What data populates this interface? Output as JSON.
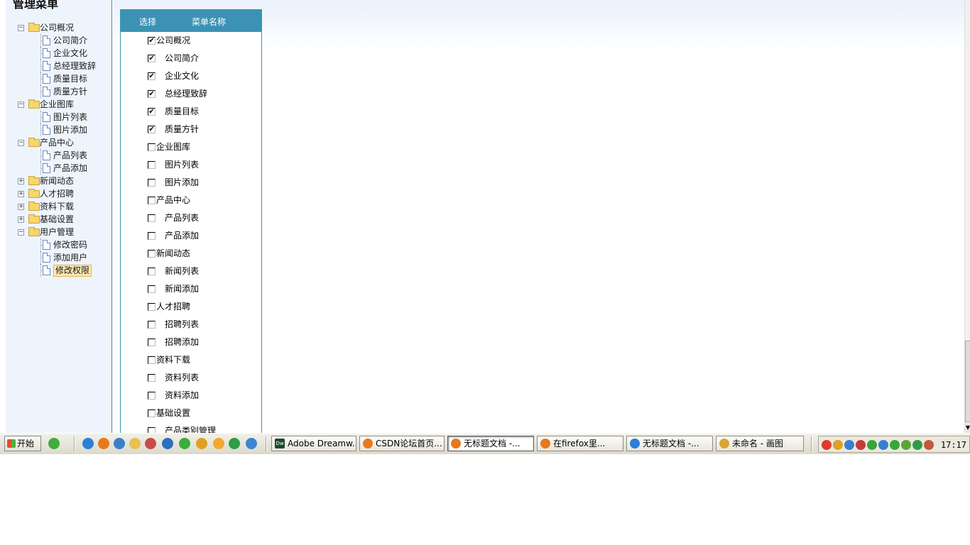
{
  "left_panel": {
    "title": "管理菜单",
    "tree": [
      {
        "label": "公司概况",
        "type": "folder",
        "toggle": "−",
        "expanded": true
      },
      {
        "label": "公司简介",
        "type": "doc"
      },
      {
        "label": "企业文化",
        "type": "doc"
      },
      {
        "label": "总经理致辞",
        "type": "doc"
      },
      {
        "label": "质量目标",
        "type": "doc"
      },
      {
        "label": "质量方针",
        "type": "doc"
      },
      {
        "label": "企业图库",
        "type": "folder",
        "toggle": "−",
        "expanded": true
      },
      {
        "label": "图片列表",
        "type": "doc"
      },
      {
        "label": "图片添加",
        "type": "doc"
      },
      {
        "label": "产品中心",
        "type": "folder",
        "toggle": "−",
        "expanded": true
      },
      {
        "label": "产品列表",
        "type": "doc"
      },
      {
        "label": "产品添加",
        "type": "doc"
      },
      {
        "label": "新闻动态",
        "type": "folder",
        "toggle": "+",
        "expanded": false
      },
      {
        "label": "人才招聘",
        "type": "folder",
        "toggle": "+",
        "expanded": false
      },
      {
        "label": "资料下载",
        "type": "folder",
        "toggle": "+",
        "expanded": false
      },
      {
        "label": "基础设置",
        "type": "folder",
        "toggle": "+",
        "expanded": false
      },
      {
        "label": "用户管理",
        "type": "folder",
        "toggle": "−",
        "expanded": true
      },
      {
        "label": "修改密码",
        "type": "doc"
      },
      {
        "label": "添加用户",
        "type": "doc"
      },
      {
        "label": "修改权限",
        "type": "doc",
        "selected": true
      }
    ]
  },
  "table": {
    "header_select": "选择",
    "header_name": "菜单名称",
    "rows": [
      {
        "label": "公司概况",
        "level": 0,
        "checked": true
      },
      {
        "label": "公司简介",
        "level": 1,
        "checked": true
      },
      {
        "label": "企业文化",
        "level": 1,
        "checked": true
      },
      {
        "label": "总经理致辞",
        "level": 1,
        "checked": true
      },
      {
        "label": "质量目标",
        "level": 1,
        "checked": true
      },
      {
        "label": "质量方针",
        "level": 1,
        "checked": true
      },
      {
        "label": "企业图库",
        "level": 0,
        "checked": false
      },
      {
        "label": "图片列表",
        "level": 1,
        "checked": false
      },
      {
        "label": "图片添加",
        "level": 1,
        "checked": false
      },
      {
        "label": "产品中心",
        "level": 0,
        "checked": false
      },
      {
        "label": "产品列表",
        "level": 1,
        "checked": false
      },
      {
        "label": "产品添加",
        "level": 1,
        "checked": false
      },
      {
        "label": "新闻动态",
        "level": 0,
        "checked": false
      },
      {
        "label": "新闻列表",
        "level": 1,
        "checked": false
      },
      {
        "label": "新闻添加",
        "level": 1,
        "checked": false
      },
      {
        "label": "人才招聘",
        "level": 0,
        "checked": false
      },
      {
        "label": "招聘列表",
        "level": 1,
        "checked": false
      },
      {
        "label": "招聘添加",
        "level": 1,
        "checked": false
      },
      {
        "label": "资料下载",
        "level": 0,
        "checked": false
      },
      {
        "label": "资料列表",
        "level": 1,
        "checked": false
      },
      {
        "label": "资料添加",
        "level": 1,
        "checked": false
      },
      {
        "label": "基础设置",
        "level": 0,
        "checked": false
      },
      {
        "label": "产品类别管理",
        "level": 1,
        "checked": false
      }
    ]
  },
  "taskbar": {
    "start_label": "开始",
    "quick_launch": [
      {
        "icon": "messenger-icon",
        "color": "#3fae3f"
      },
      {
        "icon": "ie-icon",
        "color": "#2b7fd8"
      },
      {
        "icon": "firefox-icon",
        "color": "#e8781e"
      },
      {
        "icon": "refresh-icon",
        "color": "#3a80c8"
      },
      {
        "icon": "folder-icon",
        "color": "#e8c150"
      },
      {
        "icon": "tool-icon",
        "color": "#c94a4a"
      },
      {
        "icon": "book-icon",
        "color": "#2d6fbf"
      },
      {
        "icon": "plus-icon",
        "color": "#3cae3c"
      },
      {
        "icon": "qq-icon",
        "color": "#e0a020"
      },
      {
        "icon": "face-icon",
        "color": "#f2a830"
      },
      {
        "icon": "arrow-icon",
        "color": "#2e9d47"
      },
      {
        "icon": "globe-icon",
        "color": "#3d86d6"
      }
    ],
    "tasks": [
      {
        "label": "Adobe Dreamw...",
        "icon": "dreamweaver-icon",
        "color": "#1a4d2e",
        "active": false
      },
      {
        "label": "CSDN论坛首页...",
        "icon": "firefox-icon",
        "color": "#e8781e",
        "active": false
      },
      {
        "label": "无标题文档 -...",
        "icon": "firefox-icon",
        "color": "#e8781e",
        "active": true
      },
      {
        "label": "在firefox里...",
        "icon": "firefox-icon",
        "color": "#e8781e",
        "active": false
      },
      {
        "label": "无标题文档 -...",
        "icon": "ie-icon",
        "color": "#2b7fd8",
        "active": false
      },
      {
        "label": "未命名 - 画图",
        "icon": "paint-icon",
        "color": "#d9a431",
        "active": false
      }
    ],
    "tray_icons": [
      {
        "icon": "sogou-icon",
        "color": "#e03a2a"
      },
      {
        "icon": "qq-tray-icon",
        "color": "#e0a020"
      },
      {
        "icon": "network-icon",
        "color": "#3a7fcf"
      },
      {
        "icon": "network-error-icon",
        "color": "#c63a3a"
      },
      {
        "icon": "check-icon",
        "color": "#3aa63a"
      },
      {
        "icon": "search-icon",
        "color": "#3a7fcf"
      },
      {
        "icon": "shield-icon",
        "color": "#3aa63a"
      },
      {
        "icon": "signal-icon",
        "color": "#58a63a"
      },
      {
        "icon": "plus-tray-icon",
        "color": "#2e9d47"
      },
      {
        "icon": "volume-icon",
        "color": "#c05a3a"
      }
    ],
    "clock": "17:17",
    "dreamweaver_badge": "Dw"
  }
}
